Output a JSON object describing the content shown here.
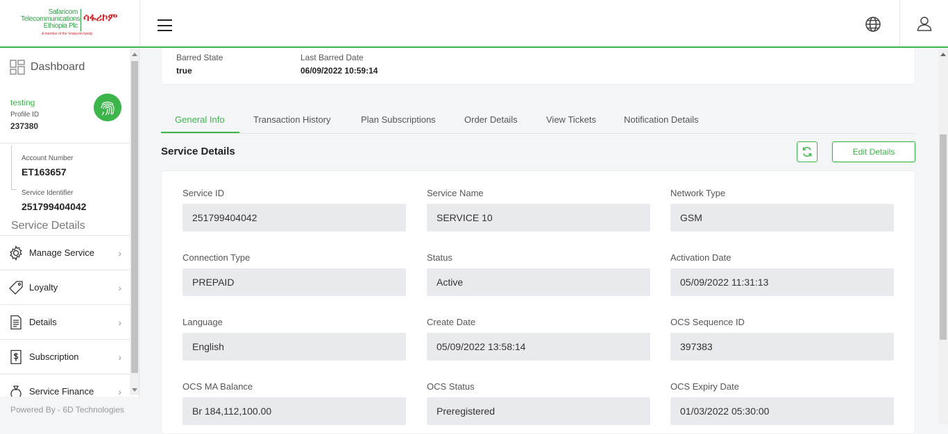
{
  "brand": {
    "logo_lines": [
      "Safaricom",
      "Telecommunications",
      "Ethiopia Plc"
    ],
    "logo_amharic": "ሳፋሪኮም",
    "logo_tagline": "A member of the Vodacom family",
    "accent_color": "#3cb54a"
  },
  "header": {
    "menu_icon": "hamburger-icon",
    "language_icon": "globe-icon",
    "profile_icon": "user-icon"
  },
  "sidebar": {
    "dashboard_label": "Dashboard",
    "profile_name": "testing",
    "profile_id_label": "Profile ID",
    "profile_id": "237380",
    "account_number_label": "Account Number",
    "account_number": "ET163657",
    "service_identifier_label": "Service Identifier",
    "service_identifier": "251799404042",
    "section_heading": "Service Details",
    "items": [
      {
        "label": "Manage Service",
        "icon": "gear-icon"
      },
      {
        "label": "Loyalty",
        "icon": "tag-icon"
      },
      {
        "label": "Details",
        "icon": "document-icon"
      },
      {
        "label": "Subscription",
        "icon": "dollar-doc-icon"
      },
      {
        "label": "Service Finance",
        "icon": "money-bag-icon"
      }
    ],
    "footer": "Powered By - 6D Technologies"
  },
  "top_card": {
    "barred_state_label": "Barred State",
    "barred_state": "true",
    "last_barred_date_label": "Last Barred Date",
    "last_barred_date": "06/09/2022 10:59:14"
  },
  "tabs": [
    "General Info",
    "Transaction History",
    "Plan Subscriptions",
    "Order Details",
    "View Tickets",
    "Notification Details"
  ],
  "active_tab": "General Info",
  "service_details": {
    "title": "Service Details",
    "edit_label": "Edit Details",
    "fields": [
      {
        "label": "Service ID",
        "value": "251799404042"
      },
      {
        "label": "Service Name",
        "value": "SERVICE 10"
      },
      {
        "label": "Network Type",
        "value": "GSM"
      },
      {
        "label": "Connection Type",
        "value": "PREPAID"
      },
      {
        "label": "Status",
        "value": "Active"
      },
      {
        "label": "Activation Date",
        "value": "05/09/2022 11:31:13"
      },
      {
        "label": "Language",
        "value": "English"
      },
      {
        "label": "Create Date",
        "value": "05/09/2022 13:58:14"
      },
      {
        "label": "OCS Sequence ID",
        "value": "397383"
      },
      {
        "label": "OCS MA Balance",
        "value": "Br 184,112,100.00"
      },
      {
        "label": "OCS Status",
        "value": "Preregistered"
      },
      {
        "label": "OCS Expiry Date",
        "value": "01/03/2022 05:30:00"
      }
    ]
  }
}
